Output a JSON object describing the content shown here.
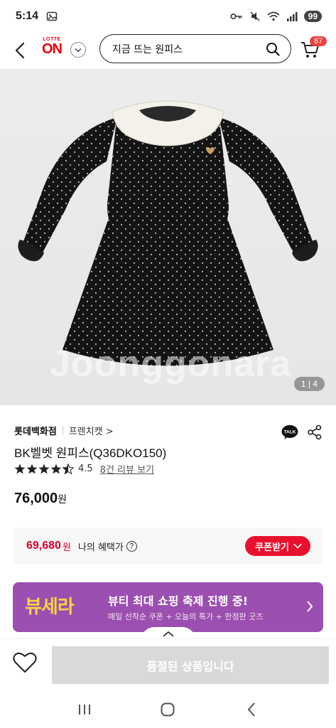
{
  "status_bar": {
    "time": "5:14",
    "battery": "99"
  },
  "header": {
    "logo_top": "LOTTE",
    "logo_main": "ON",
    "search_value": "지금 뜨는 원피스",
    "cart_count": "87"
  },
  "product": {
    "image_watermark": "Joonggonara",
    "image_counter": "1 | 4",
    "brand": "롯데백화점",
    "sub_brand": "프렌치캣 >",
    "title": "BK벨벳 원피스(Q36DKO150)",
    "rating": "4.5",
    "rating_stars": 4.5,
    "review_link": "8건 리뷰 보기",
    "price": "76,000",
    "price_unit": "원",
    "talk_label": "TALK"
  },
  "benefit": {
    "price": "69,680",
    "unit": "원",
    "label": "나의 혜택가",
    "info_icon": "?",
    "coupon_button": "쿠폰받기"
  },
  "banner": {
    "logo": "뷰세라",
    "title": "뷰티 최대 쇼핑 축제 진행 중!",
    "subtitle": "매일 선착순 쿠폰 + 오늘의 특가 + 한정판 굿즈"
  },
  "bottom_bar": {
    "soldout_label": "품절된 상품입니다"
  },
  "colors": {
    "brand_red": "#e60012",
    "benefit_red": "#e0002a",
    "banner_purple": "#9b4fb0",
    "banner_yellow": "#f4d442",
    "disabled_gray": "#d9d9d9"
  }
}
